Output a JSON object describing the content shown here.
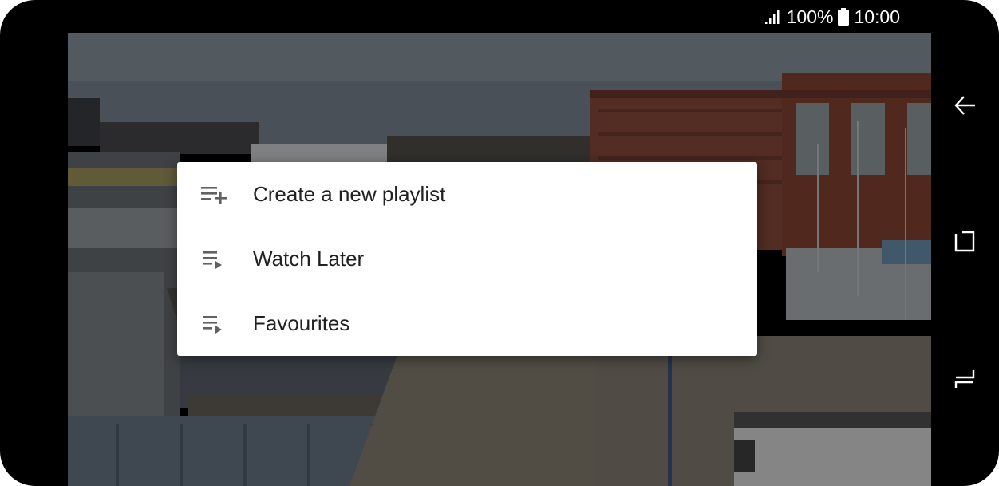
{
  "status_bar": {
    "battery_text": "100%",
    "time": "10:00",
    "icons": [
      "signal-icon",
      "battery-icon"
    ]
  },
  "dialog": {
    "items": [
      {
        "label": "Create a new playlist",
        "icon": "playlist-add-icon"
      },
      {
        "label": "Watch Later",
        "icon": "playlist-play-icon"
      },
      {
        "label": "Favourites",
        "icon": "playlist-play-icon"
      }
    ]
  },
  "nav_bar": {
    "buttons": [
      "back-icon",
      "recents-icon",
      "home-icon"
    ]
  },
  "colors": {
    "dialog_bg": "#ffffff",
    "text": "#212121",
    "icon": "#616161",
    "frame": "#000000"
  }
}
